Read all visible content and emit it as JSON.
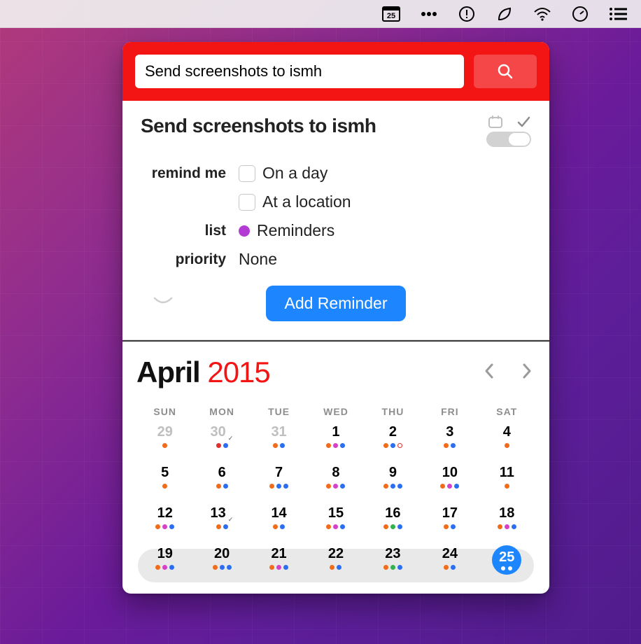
{
  "menubar": {
    "calendar_day": "25"
  },
  "search": {
    "value": "Send screenshots to ismh"
  },
  "task": {
    "title": "Send screenshots to ismh",
    "toggle_state": "reminder",
    "fields": {
      "remind_label": "remind me",
      "on_a_day": "On a day",
      "at_location": "At a location",
      "list_label": "list",
      "list_value": "Reminders",
      "list_color": "#b33bd4",
      "priority_label": "priority",
      "priority_value": "None"
    },
    "add_button": "Add Reminder"
  },
  "calendar": {
    "month": "April",
    "year": "2015",
    "dow": [
      "SUN",
      "MON",
      "TUE",
      "WED",
      "THU",
      "FRI",
      "SAT"
    ],
    "today": 25,
    "weeks": [
      [
        {
          "n": 29,
          "prev": true,
          "dots": [
            "orange"
          ]
        },
        {
          "n": 30,
          "prev": true,
          "dots": [
            "red",
            "blue"
          ],
          "tick": true
        },
        {
          "n": 31,
          "prev": true,
          "dots": [
            "orange",
            "blue"
          ]
        },
        {
          "n": 1,
          "dots": [
            "orange",
            "magenta",
            "blue"
          ]
        },
        {
          "n": 2,
          "dots": [
            "orange",
            "blue",
            "ring"
          ]
        },
        {
          "n": 3,
          "dots": [
            "orange",
            "blue"
          ]
        },
        {
          "n": 4,
          "dots": [
            "orange"
          ]
        }
      ],
      [
        {
          "n": 5,
          "dots": [
            "orange"
          ]
        },
        {
          "n": 6,
          "dots": [
            "orange",
            "blue"
          ]
        },
        {
          "n": 7,
          "dots": [
            "orange",
            "blue",
            "blue"
          ]
        },
        {
          "n": 8,
          "dots": [
            "orange",
            "magenta",
            "blue"
          ]
        },
        {
          "n": 9,
          "dots": [
            "orange",
            "blue",
            "blue"
          ]
        },
        {
          "n": 10,
          "dots": [
            "orange",
            "magenta",
            "blue"
          ]
        },
        {
          "n": 11,
          "dots": [
            "orange"
          ]
        }
      ],
      [
        {
          "n": 12,
          "dots": [
            "orange",
            "magenta",
            "blue"
          ]
        },
        {
          "n": 13,
          "dots": [
            "orange",
            "blue"
          ],
          "tick": true
        },
        {
          "n": 14,
          "dots": [
            "orange",
            "blue"
          ]
        },
        {
          "n": 15,
          "dots": [
            "orange",
            "magenta",
            "blue"
          ]
        },
        {
          "n": 16,
          "dots": [
            "orange",
            "green",
            "blue"
          ]
        },
        {
          "n": 17,
          "dots": [
            "orange",
            "blue"
          ]
        },
        {
          "n": 18,
          "dots": [
            "orange",
            "magenta",
            "blue"
          ]
        }
      ],
      [
        {
          "n": 19,
          "dots": [
            "orange",
            "magenta",
            "blue"
          ]
        },
        {
          "n": 20,
          "dots": [
            "orange",
            "blue",
            "blue"
          ]
        },
        {
          "n": 21,
          "dots": [
            "orange",
            "magenta",
            "blue"
          ]
        },
        {
          "n": 22,
          "dots": [
            "orange",
            "blue"
          ]
        },
        {
          "n": 23,
          "dots": [
            "orange",
            "green",
            "blue"
          ]
        },
        {
          "n": 24,
          "dots": [
            "orange",
            "blue"
          ]
        },
        {
          "n": 25,
          "today": true,
          "dots": [
            "white",
            "white"
          ]
        }
      ]
    ]
  }
}
